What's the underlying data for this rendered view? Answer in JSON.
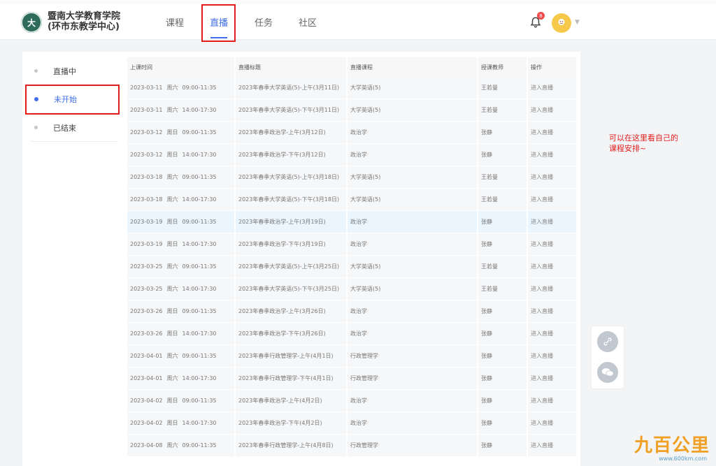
{
  "header": {
    "logo_glyph": "大",
    "logo_line1": "暨南大学教育学院",
    "logo_line2": "(环市东教学中心)",
    "nav": [
      "课程",
      "直播",
      "任务",
      "社区"
    ],
    "active_nav": "直播",
    "notification_count": "8"
  },
  "sidebar": {
    "items": [
      "直播中",
      "未开始",
      "已结束"
    ],
    "active": "未开始"
  },
  "table": {
    "headers": [
      "上课时间",
      "直播标题",
      "直播课程",
      "授课教师",
      "操作"
    ],
    "rows": [
      {
        "date": "2023-03-11",
        "weekday": "周六",
        "time": "09:00-11:35",
        "title": "2023年春季大学英语(5)-上午(3月11日)",
        "course": "大学英语(5)",
        "teacher": "王若曼",
        "op": "进入直播"
      },
      {
        "date": "2023-03-11",
        "weekday": "周六",
        "time": "14:00-17:30",
        "title": "2023年春季大学英语(5)-下午(3月11日)",
        "course": "大学英语(5)",
        "teacher": "王若曼",
        "op": "进入直播"
      },
      {
        "date": "2023-03-12",
        "weekday": "周日",
        "time": "09:00-11:35",
        "title": "2023年春季政治学-上午(3月12日)",
        "course": "政治学",
        "teacher": "张静",
        "op": "进入直播"
      },
      {
        "date": "2023-03-12",
        "weekday": "周日",
        "time": "14:00-17:30",
        "title": "2023年春季政治学-下午(3月12日)",
        "course": "政治学",
        "teacher": "张静",
        "op": "进入直播"
      },
      {
        "date": "2023-03-18",
        "weekday": "周六",
        "time": "09:00-11:35",
        "title": "2023年春季大学英语(5)-上午(3月18日)",
        "course": "大学英语(5)",
        "teacher": "王若曼",
        "op": "进入直播"
      },
      {
        "date": "2023-03-18",
        "weekday": "周六",
        "time": "14:00-17:30",
        "title": "2023年春季大学英语(5)-下午(3月18日)",
        "course": "大学英语(5)",
        "teacher": "王若曼",
        "op": "进入直播"
      },
      {
        "date": "2023-03-19",
        "weekday": "周日",
        "time": "09:00-11:35",
        "title": "2023年春季政治学-上午(3月19日)",
        "course": "政治学",
        "teacher": "张静",
        "op": "进入直播",
        "highlight": true
      },
      {
        "date": "2023-03-19",
        "weekday": "周日",
        "time": "14:00-17:30",
        "title": "2023年春季政治学-下午(3月19日)",
        "course": "政治学",
        "teacher": "张静",
        "op": "进入直播"
      },
      {
        "date": "2023-03-25",
        "weekday": "周六",
        "time": "09:00-11:35",
        "title": "2023年春季大学英语(5)-上午(3月25日)",
        "course": "大学英语(5)",
        "teacher": "王若曼",
        "op": "进入直播"
      },
      {
        "date": "2023-03-25",
        "weekday": "周六",
        "time": "14:00-17:30",
        "title": "2023年春季大学英语(5)-下午(3月25日)",
        "course": "大学英语(5)",
        "teacher": "王若曼",
        "op": "进入直播"
      },
      {
        "date": "2023-03-26",
        "weekday": "周日",
        "time": "09:00-11:35",
        "title": "2023年春季政治学-上午(3月26日)",
        "course": "政治学",
        "teacher": "张静",
        "op": "进入直播"
      },
      {
        "date": "2023-03-26",
        "weekday": "周日",
        "time": "14:00-17:30",
        "title": "2023年春季政治学-下午(3月26日)",
        "course": "政治学",
        "teacher": "张静",
        "op": "进入直播"
      },
      {
        "date": "2023-04-01",
        "weekday": "周六",
        "time": "09:00-11:35",
        "title": "2023年春季行政管理学-上午(4月1日)",
        "course": "行政管理学",
        "teacher": "张静",
        "op": "进入直播"
      },
      {
        "date": "2023-04-01",
        "weekday": "周六",
        "time": "14:00-17:30",
        "title": "2023年春季行政管理学-下午(4月1日)",
        "course": "行政管理学",
        "teacher": "张静",
        "op": "进入直播"
      },
      {
        "date": "2023-04-02",
        "weekday": "周日",
        "time": "09:00-11:35",
        "title": "2023年春季政治学-上午(4月2日)",
        "course": "政治学",
        "teacher": "张静",
        "op": "进入直播"
      },
      {
        "date": "2023-04-02",
        "weekday": "周日",
        "time": "14:00-17:30",
        "title": "2023年春季政治学-下午(4月2日)",
        "course": "政治学",
        "teacher": "张静",
        "op": "进入直播"
      },
      {
        "date": "2023-04-08",
        "weekday": "周六",
        "time": "09:00-11:35",
        "title": "2023年春季行政管理学-上午(4月8日)",
        "course": "行政管理学",
        "teacher": "张静",
        "op": "进入直播"
      }
    ]
  },
  "annotation": {
    "line1": "可以在这里看自己的",
    "line2": "课程安排~"
  },
  "watermark": {
    "title": "九百公里",
    "url": "www.600km.com"
  },
  "icons": {
    "bell": "bell-icon",
    "link": "link-icon",
    "wechat": "wechat-icon"
  },
  "colors": {
    "accent": "#3f6ee7",
    "highlight_box": "#e31c1c"
  }
}
